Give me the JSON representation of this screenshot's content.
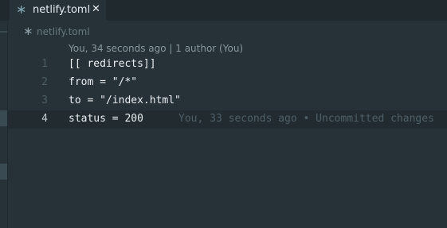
{
  "tab": {
    "icon": "asterisk-icon",
    "label": "netlify.toml",
    "close": "✕"
  },
  "breadcrumb": {
    "icon": "asterisk-icon",
    "label": "netlify.toml"
  },
  "blame_header": "You, 34 seconds ago | 1 author (You)",
  "editor": {
    "lines": [
      {
        "number": "1",
        "text": "[[ redirects]]"
      },
      {
        "number": "2",
        "text": "from = \"/*\""
      },
      {
        "number": "3",
        "text": "to = \"/index.html\""
      },
      {
        "number": "4",
        "text": "status = 200"
      }
    ],
    "current_line": 4,
    "inline_blame": "You, 33 seconds ago • Uncommitted changes"
  },
  "colors": {
    "background": "#263238",
    "tabbar": "#1f292e",
    "current_line": "#212b30"
  }
}
